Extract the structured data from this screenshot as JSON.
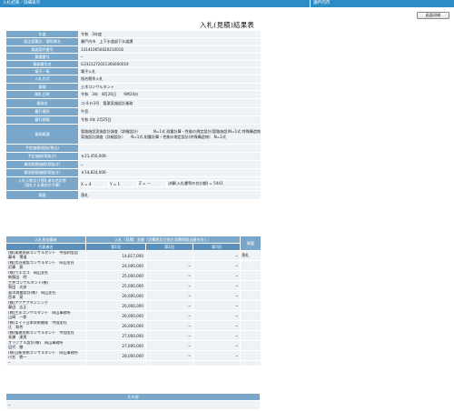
{
  "topbar": {
    "breadcrumb": "入札結果／詳細表示",
    "org": "瀬戸内市"
  },
  "print_button": "画面印刷",
  "title": "入札(見積)結果表",
  "info_rows": [
    {
      "label": "年度",
      "value": "令和　3年度"
    },
    {
      "label": "発注部署名／課所属名",
      "value": "瀬戸内市　上下水道部下水道課"
    },
    {
      "label": "調達案件番号",
      "value": "331410656020210018"
    },
    {
      "label": "業種番号",
      "value": "─"
    },
    {
      "label": "業務番号名",
      "value": "G332127202136S600019"
    },
    {
      "label": "電子／紙",
      "value": "電子入札"
    },
    {
      "label": "入札方式",
      "value": "指名競争入札"
    },
    {
      "label": "業種",
      "value": "土木コンサルタント"
    },
    {
      "label": "開札日時",
      "value": "令和　3年　8月26日　　9時24分"
    },
    {
      "label": "業務名",
      "value": "コ-4-ﾀｲ3号　管渠実施設計業務"
    },
    {
      "label": "履行場所",
      "value": "牛窓"
    },
    {
      "label": "履行期限",
      "value": "令和 4年 2月25日"
    },
    {
      "label": "業務概要",
      "value": "管路施設実施設計調査（詳細設計）　　　　N=1式  耐震計算・性能の規定設計(管路施設)N=1式 特殊構造物実施設計調査（詳細設計）　　N=1式  耐震計算・性能の規定設計(特殊構造物)　N=1式"
    },
    {
      "label": "予定価格(税抜/税込)",
      "value": ""
    },
    {
      "label": "予定価格(税抜き)",
      "value": "￥21,450,000-"
    },
    {
      "label": "最低制限価格(税抜き)",
      "value": "─"
    },
    {
      "label": "最低制限価格(税抜き)",
      "value": "￥14,824,000-"
    },
    {
      "label": "入札人数",
      "value": ""
    },
    {
      "label": "摘要",
      "value": "落札"
    }
  ],
  "counts": {
    "label": "入札人数及び落札者の合計数\n(落札する場合の予算)",
    "x": "X = 4",
    "y": "Y = 1",
    "z": "Z = －",
    "total": "決算(入札書等の合計額) = 5441"
  },
  "results": {
    "group_header": "入札参加業者",
    "amount_header": "入札（見積）金額（消費税及び地方消費税相当額を除く）",
    "remarks_header": "摘要",
    "sub_headers": [
      "代表者名",
      "第1回",
      "第2回",
      "第3回"
    ],
    "rows": [
      {
        "name": "(株)東建技研コンサルタント　中国四支店\n藤本　博道",
        "r1": "14,817,000",
        "r2": "",
        "r3": "─",
        "remark": "落札"
      },
      {
        "name": "(株)荒谷建設コンサルタント　岡山支社\n近藤　振",
        "r1": "24,000,000",
        "r2": "─",
        "r3": "─",
        "remark": ""
      },
      {
        "name": "(株)ウエスコ　岡山支社\n新飯田　明",
        "r1": "25,000,000",
        "r2": "─",
        "r3": "─",
        "remark": ""
      },
      {
        "name": "三井コンサルタント(株)\n和田　光彦",
        "r1": "25,000,000",
        "r2": "─",
        "r3": "─",
        "remark": ""
      },
      {
        "name": "東洋測量設計(株)　岡山支社\n西本　晃",
        "r1": "26,000,000",
        "r2": "─",
        "r3": "─",
        "remark": ""
      },
      {
        "name": "(株)アクアプランニング\n藤田　吉正",
        "r1": "26,000,000",
        "r2": "─",
        "r3": "─",
        "remark": ""
      },
      {
        "name": "(株)三水コンサルタント　岡山事務所\n山崎　一郎",
        "r1": "26,000,000",
        "r2": "─",
        "r3": "─",
        "remark": ""
      },
      {
        "name": "(株)エイト日本技術開発　中国支社\n辻　和秀",
        "r1": "26,000,000",
        "r2": "─",
        "r3": "─",
        "remark": ""
      },
      {
        "name": "(株)復建技術コンサルタント　中国支社\n長瀬　達男",
        "r1": "27,000,000",
        "r2": "─",
        "r3": "─",
        "remark": ""
      },
      {
        "name": "オリジナル設計(株)　岡山事務所\n田代　徹",
        "r1": "27,000,000",
        "r2": "─",
        "r3": "─",
        "remark": ""
      },
      {
        "name": "(株)日新技術コンサルタント　岡山事務所\n川名　徳一",
        "r1": "28,000,000",
        "r2": "─",
        "r3": "─",
        "remark": ""
      },
      {
        "name": "─",
        "r1": "",
        "r2": "",
        "r3": "",
        "remark": ""
      }
    ]
  },
  "other": {
    "header": "その他",
    "value": "─"
  },
  "colors": {
    "header_blue": "#7aa7c9",
    "topbar_blue": "#2d8cc6",
    "cell_bg": "#eef3f8"
  }
}
